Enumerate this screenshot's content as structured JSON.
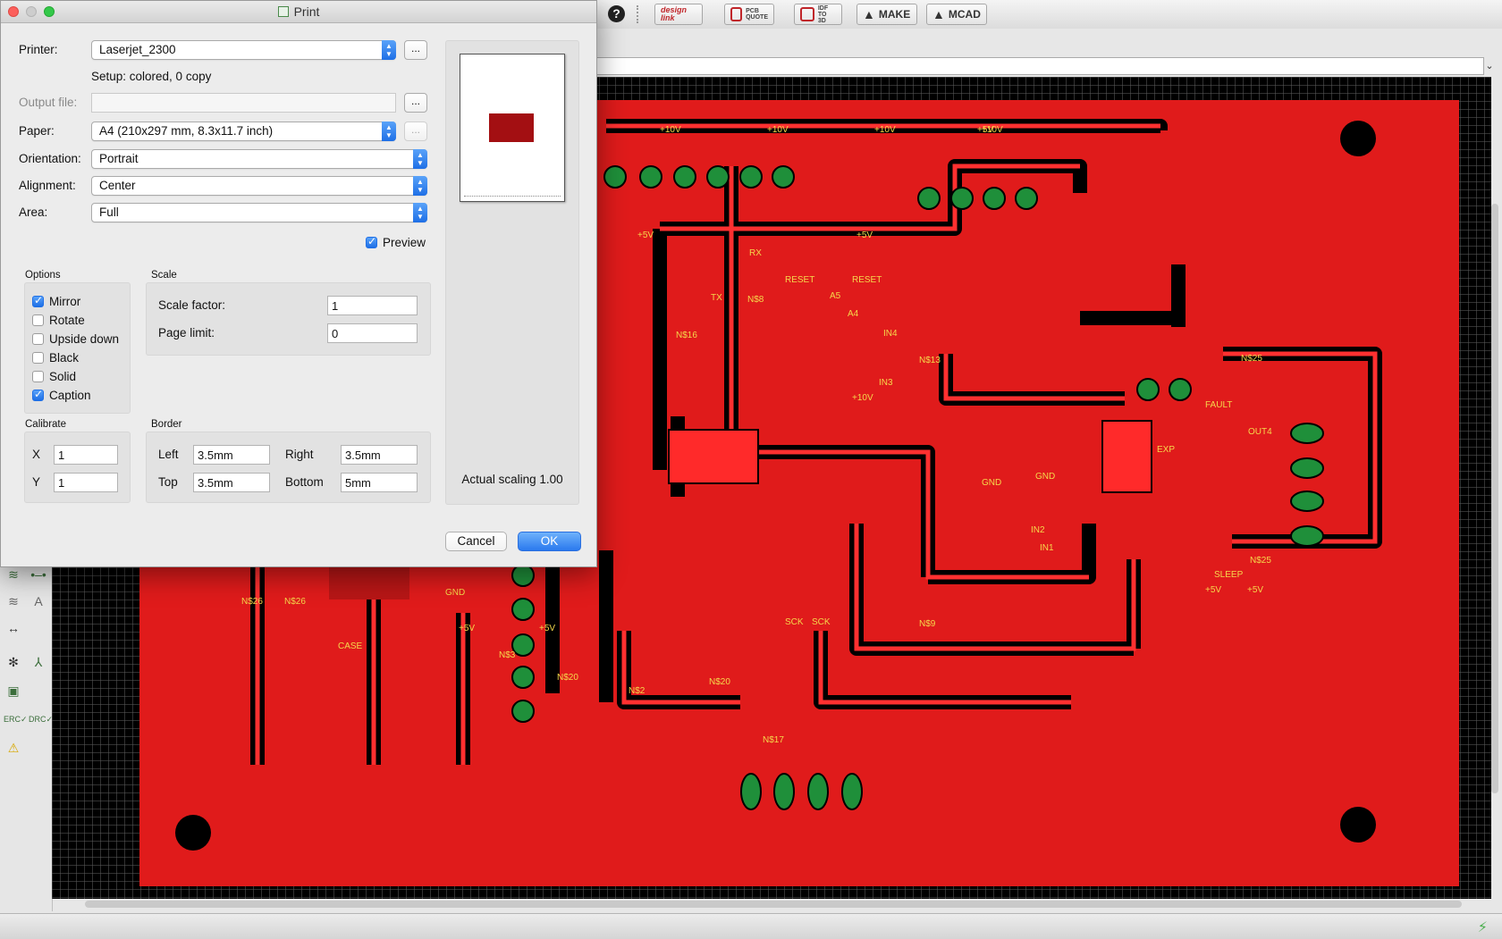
{
  "toolbar": {
    "help_label": "?",
    "buttons": [
      {
        "name": "design-link-button",
        "top": "design",
        "bottom": "link"
      },
      {
        "name": "pcb-quote-button",
        "top": "PCB",
        "bottom": "QUOTE"
      },
      {
        "name": "idf-to-3d-button",
        "top": "IDF",
        "bottom": "TO 3D"
      },
      {
        "name": "make-button",
        "label": "MAKE"
      },
      {
        "name": "mcad-button",
        "label": "MCAD"
      }
    ]
  },
  "dialog": {
    "title": "Print",
    "printer_label": "Printer:",
    "printer_value": "Laserjet_2300",
    "more_label": "...",
    "setup_text": "Setup: colored, 0 copy",
    "output_file_label": "Output file:",
    "output_file_value": "",
    "paper_label": "Paper:",
    "paper_value": "A4 (210x297 mm, 8.3x11.7 inch)",
    "orientation_label": "Orientation:",
    "orientation_value": "Portrait",
    "alignment_label": "Alignment:",
    "alignment_value": "Center",
    "area_label": "Area:",
    "area_value": "Full",
    "preview_label": "Preview",
    "preview_checked": true,
    "options_title": "Options",
    "options": [
      {
        "label": "Mirror",
        "checked": true
      },
      {
        "label": "Rotate",
        "checked": false
      },
      {
        "label": "Upside down",
        "checked": false
      },
      {
        "label": "Black",
        "checked": false
      },
      {
        "label": "Solid",
        "checked": false
      },
      {
        "label": "Caption",
        "checked": true
      }
    ],
    "scale_title": "Scale",
    "scale_factor_label": "Scale factor:",
    "scale_factor_value": "1",
    "page_limit_label": "Page limit:",
    "page_limit_value": "0",
    "calibrate_title": "Calibrate",
    "calibrate_x_label": "X",
    "calibrate_x_value": "1",
    "calibrate_y_label": "Y",
    "calibrate_y_value": "1",
    "border_title": "Border",
    "border_left_label": "Left",
    "border_left_value": "3.5mm",
    "border_right_label": "Right",
    "border_right_value": "3.5mm",
    "border_top_label": "Top",
    "border_top_value": "3.5mm",
    "border_bottom_label": "Bottom",
    "border_bottom_value": "5mm",
    "actual_scaling": "Actual scaling 1.00",
    "cancel_label": "Cancel",
    "ok_label": "OK"
  },
  "board": {
    "copper_color": "#e01b1b",
    "pad_color": "#1f8f3a",
    "label_color": "#f5d84b",
    "labels": [
      "+10V",
      "+10V",
      "+10V",
      "+10V",
      "+5V",
      "+5V",
      "+5V",
      "RESET",
      "RESET",
      "A5",
      "A4",
      "IN4",
      "N$13",
      "IN3",
      "+10V",
      "GND",
      "GND",
      "N$25",
      "OUT4",
      "SLEEP",
      "IN2",
      "IN1",
      "N$25",
      "+5V",
      "+5V",
      "SCK",
      "SCK",
      "N$9",
      "N$2",
      "N$20",
      "N$20",
      "N$17",
      "N$3",
      "+5V",
      "+5V",
      "CASE",
      "GND",
      "N$26",
      "N$26",
      "RX",
      "TX",
      "N$8",
      "N$16",
      "FAULT",
      "EXP"
    ]
  }
}
